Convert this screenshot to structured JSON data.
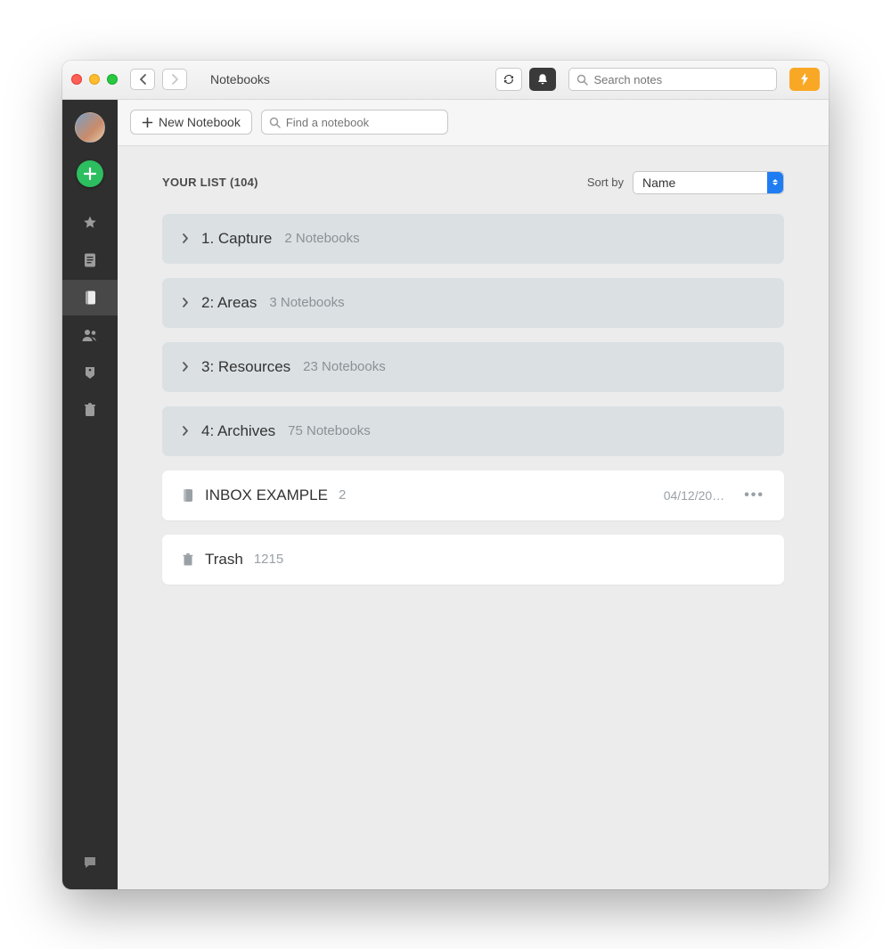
{
  "titlebar": {
    "title": "Notebooks",
    "search_placeholder": "Search notes"
  },
  "toolbar": {
    "new_notebook_label": "New Notebook",
    "find_placeholder": "Find a notebook"
  },
  "sort": {
    "label": "Sort by",
    "value": "Name"
  },
  "list": {
    "heading": "YOUR LIST (104)",
    "stacks": [
      {
        "name": "1. Capture",
        "sub": "2 Notebooks"
      },
      {
        "name": "2: Areas",
        "sub": "3 Notebooks"
      },
      {
        "name": "3: Resources",
        "sub": "23 Notebooks"
      },
      {
        "name": "4: Archives",
        "sub": "75 Notebooks"
      }
    ],
    "notebooks": [
      {
        "kind": "notebook",
        "name": "INBOX EXAMPLE",
        "count": "2",
        "date": "04/12/20…",
        "show_more": true
      },
      {
        "kind": "trash",
        "name": "Trash",
        "count": "1215",
        "date": "",
        "show_more": false
      }
    ]
  }
}
